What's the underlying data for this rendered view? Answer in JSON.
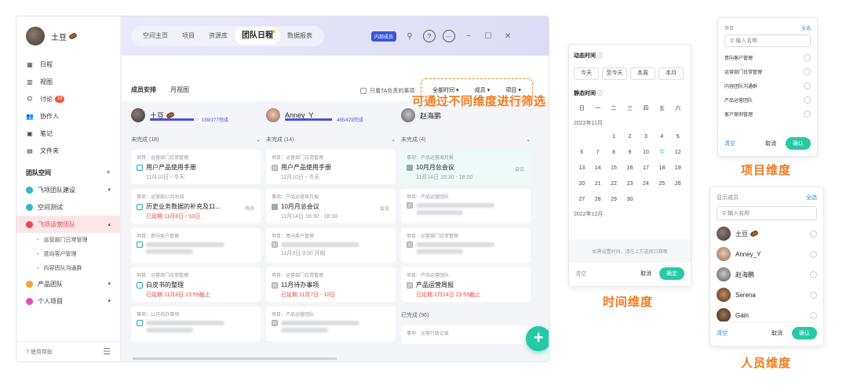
{
  "sidebar": {
    "user_name": "土豆",
    "items": [
      {
        "label": "日程",
        "icon": "calendar-icon"
      },
      {
        "label": "视图",
        "icon": "chart-icon"
      },
      {
        "label": "讨论",
        "icon": "discussion-icon",
        "badge": "19"
      },
      {
        "label": "协作人",
        "icon": "users-icon"
      },
      {
        "label": "笔记",
        "icon": "note-icon"
      },
      {
        "label": "文件夹",
        "icon": "folder-icon"
      }
    ],
    "section_label": "团队空间",
    "section_add": "+",
    "projects": [
      {
        "label": "飞项团队建设",
        "color": "#2fb6c9",
        "arrow": "▾"
      },
      {
        "label": "空间测试",
        "color": "#2fb6c9",
        "arrow": ""
      },
      {
        "label": "飞项运营团队",
        "color": "#e8474f",
        "arrow": "▴",
        "active": true
      }
    ],
    "subitems": [
      "运营部门日常管理",
      "意向客户管理",
      "内容团队沟通群"
    ],
    "projects2": [
      {
        "label": "产品团队",
        "color": "#f3a23a",
        "arrow": "▾"
      },
      {
        "label": "个人项目",
        "color": "#e04fb0",
        "arrow": "▾"
      }
    ],
    "help": "使用帮助"
  },
  "topbar": {
    "tabs": [
      "空间主页",
      "项目",
      "资源库",
      "团队日程",
      "数据报表"
    ],
    "active_tab": "团队日程",
    "inner_badge": "内部成员"
  },
  "view_tabs": [
    "成员安排",
    "月视图"
  ],
  "only_me": "只看TA负责的事项",
  "filters": [
    "全部时间 ▾",
    "成员 ▾",
    "项目 ▾"
  ],
  "annotation": "可通过不同维度进行筛选",
  "members": [
    {
      "name": "土豆",
      "progress": "159/177完成",
      "ratio": 0.9
    },
    {
      "name": "Anney_Y",
      "progress": "465/479完成",
      "ratio": 0.97
    },
    {
      "name": "赵海鹏",
      "progress": "",
      "ratio": 0
    }
  ],
  "columns": [
    {
      "header": "未完成 (18)",
      "cards": [
        {
          "ctx": "项目：运营部门日常管理",
          "title": "用户产品使用手册",
          "date": "11月10日 - 今天",
          "date_red": false,
          "kind": "task"
        },
        {
          "ctx": "事项：运营部10月总结",
          "title": "历史业务数据的补充及11...",
          "tag": "待办",
          "date": "已延期 11月8日 - 10日",
          "date_red": true,
          "kind": "task"
        },
        {
          "ctx": "项目：意向客户管理",
          "title": "",
          "date": "",
          "date_red": false,
          "kind": "task"
        },
        {
          "ctx": "项目：运营部门日常管理",
          "title": "白皮书的整理",
          "date": "已延期 11月8日 23:59截止",
          "date_red": true,
          "kind": "task"
        },
        {
          "ctx": "事项：11月待办事项",
          "title": "",
          "date": "",
          "date_red": false,
          "kind": "task"
        }
      ]
    },
    {
      "header": "未完成 (14)",
      "cards": [
        {
          "ctx": "项目：运营部门日常管理",
          "title": "用户产品使用手册",
          "date": "11月10日 - 今天",
          "date_red": false,
          "kind": "gray"
        },
        {
          "ctx": "事项：产品运营周月报",
          "title": "10月月总会议",
          "tag": "会议",
          "date": "11月14日 16:30 - 18:00",
          "date_red": false,
          "kind": "meet"
        },
        {
          "ctx": "项目：意向客户管理",
          "title": "",
          "date": "11月9日 9:00 开始",
          "date_red": false,
          "kind": "gray"
        },
        {
          "ctx": "项目：运营部门日常管理",
          "title": "11月待办事项",
          "date": "已延期 11月7日 - 10日",
          "date_red": true,
          "kind": "gray"
        },
        {
          "ctx": "项目：产品运营团队",
          "title": "",
          "date": "",
          "date_red": false,
          "kind": "gray"
        }
      ]
    },
    {
      "header": "未完成 (4)",
      "cards": [
        {
          "ctx": "事项：产品运营周月报",
          "title": "10月月总会议",
          "tag": "会议",
          "date": "11月14日 16:30 - 18:00",
          "date_red": false,
          "kind": "meet",
          "teal": true
        },
        {
          "ctx": "项目：产品运营团队",
          "title": "",
          "date": "",
          "date_red": false,
          "kind": "gray"
        },
        {
          "ctx": "项目：运营部门日常管理",
          "title": "",
          "date": "",
          "date_red": false,
          "kind": "gray"
        },
        {
          "ctx": "项目：产品运营团队",
          "title": "产品运营周报",
          "date": "已延期 2月14日 23:59截止",
          "date_red": true,
          "kind": "gray"
        }
      ],
      "done_header": "已完成 (96)",
      "done_ctx": "事项：运营行政记录"
    }
  ],
  "time_panel": {
    "dynamic_label": "动态时间",
    "quick": [
      "今天",
      "至今天",
      "本周",
      "本月"
    ],
    "static_label": "静态时间",
    "weekdays": [
      "日",
      "一",
      "二",
      "三",
      "四",
      "五",
      "六"
    ],
    "month1": "2022年11月",
    "weeks": [
      [
        "",
        "",
        "1",
        "2",
        "3",
        "4",
        "5"
      ],
      [
        "6",
        "7",
        "8",
        "9",
        "10",
        "今",
        "12"
      ],
      [
        "13",
        "14",
        "15",
        "16",
        "17",
        "18",
        "19"
      ],
      [
        "20",
        "21",
        "22",
        "23",
        "24",
        "25",
        "26"
      ],
      [
        "27",
        "28",
        "29",
        "30",
        "",
        "",
        ""
      ]
    ],
    "month2": "2022年12月",
    "hint": "如需设置时间，请在上方选择日期哦",
    "clear": "清空",
    "cancel": "取消",
    "ok": "确定",
    "caption": "时间维度"
  },
  "project_panel": {
    "title": "项目",
    "select_all": "全选",
    "placeholder": "输入名称",
    "items": [
      "意向客户管理",
      "运营部门日常管理",
      "内容团队沟通群",
      "产品运营团队",
      "客户案例管理"
    ],
    "clear": "清空",
    "cancel": "取消",
    "ok": "确认",
    "caption": "项目维度"
  },
  "member_panel": {
    "title": "显示成员",
    "select_all": "全选",
    "placeholder": "输入名称",
    "members": [
      "土豆",
      "Anney_Y",
      "赵海鹏",
      "Serena",
      "Gain"
    ],
    "clear": "清空",
    "cancel": "取消",
    "ok": "确认",
    "caption": "人员维度"
  }
}
